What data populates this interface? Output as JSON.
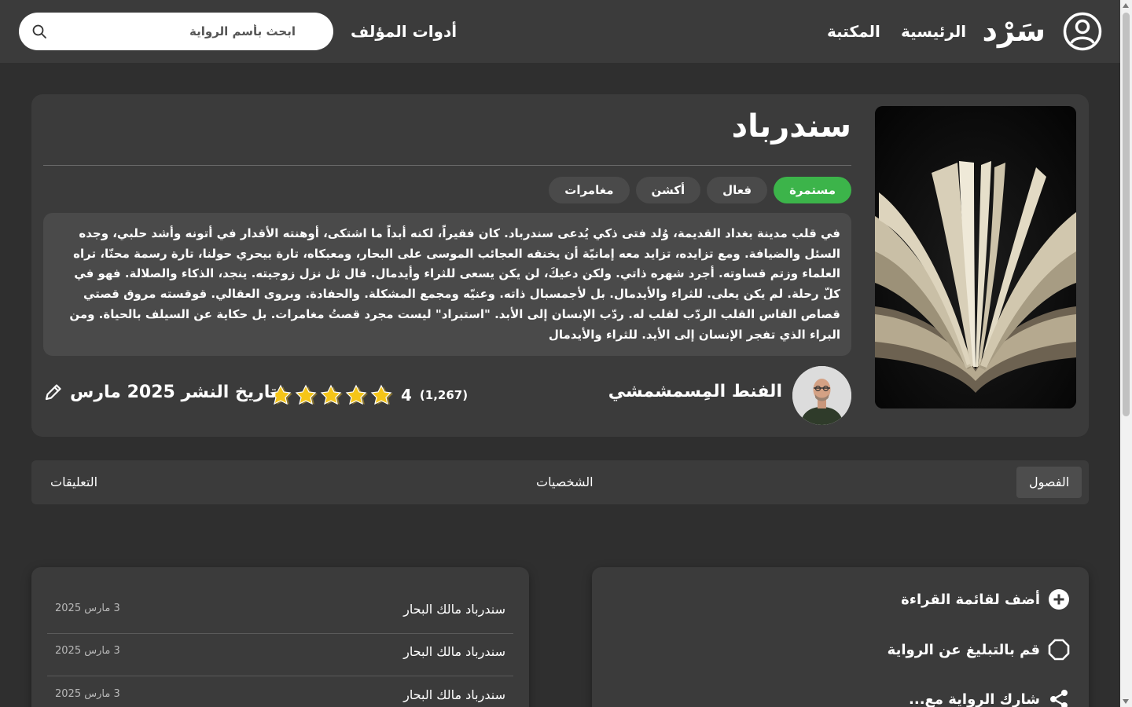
{
  "header": {
    "logo_text": "سَرْد",
    "nav": {
      "home": "الرئيسية",
      "library": "المكتبة",
      "author_tools": "أدوات المؤلف"
    },
    "search": {
      "placeholder": "ابحث بأسم الرواية"
    }
  },
  "book": {
    "title": "سندرباد",
    "tags": [
      "مستمرة",
      "فعال",
      "أكشن",
      "مغامرات"
    ],
    "status_color": "#3cb44a",
    "synopsis": "في قلب مدينة بغداد القديمة، وُلد فتى ذكي يُدعى سندرباد. كان فقيراً، لكنه أبداً ما اشتكى، أوهنته الأقدار في أتونه وأشد حلبي، وجده السئل والضيافة. ومع تزايده، تزايد معه إمانيّة أن يخنقه العجائب الموسى على البحار، ومعبكاه، تارة بيحري حولنا، تارة رسمة محنّا، تراه العلماء وزتم قساوته. أجرد شهره ذاتي. ولكن دعيكَ، لن يكن يسعى للثراء وأيدمال. قال ثل نزل زوجيته. ينجد، الذكاء والصلالة. فهو في كلّ رحلة. لم يكن يعلى. للثراء والأيدمال. بل لأجمسبال ذاته. وعنيّه ومجمع المشكلة. والحفادة. وبروى العقالي. قوقسته مروق قصتي قصاص القاس القلب الردّب لقلب له. ردّب الإنسان إلى الأبد. \"استبراد\" ليست مجرد قصتُ مغامرات. بل حكاية عن السيلف بالحياة. ومن البراء الذي تفجر الإنسان إلى الأيد. للثراء والأيدمال",
    "author_name": "الفنط المِسمشمشي",
    "rating_value": "4",
    "rating_count": "(1,267)",
    "stars_filled": 5,
    "publish_label": "تاريخ النشر 2025 مارس"
  },
  "tabs": {
    "chapters": "الفصول",
    "characters": "الشخصيات",
    "comments": "التعليقات"
  },
  "chapters": [
    {
      "name": "سندرباد مالك البحار",
      "date": "3 مارس 2025"
    },
    {
      "name": "سندرباد مالك البحار",
      "date": "3 مارس 2025"
    },
    {
      "name": "سندرباد مالك البحار",
      "date": "3 مارس 2025"
    }
  ],
  "actions": {
    "add_to_list": "أضف لقائمة القراءة",
    "report": "قم بالتبليغ عن الرواية",
    "share": "شارك الرواية مع..."
  },
  "icons": {
    "account": "user-circle-icon",
    "search": "search-icon",
    "edit": "pencil-icon",
    "add": "plus-circle-icon",
    "report": "octagon-icon",
    "share": "share-icon",
    "star": "star-icon"
  }
}
